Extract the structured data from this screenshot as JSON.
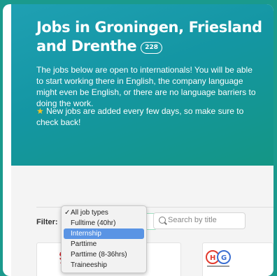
{
  "hero": {
    "title": "Jobs in Groningen, Friesland and Drenthe",
    "count": "228",
    "intro": "The jobs below are open to internationals! You will be able to start working there in English, the company language might even be English, or there are no language barriers to doing the work.",
    "note": "New jobs are added every few days, so make sure to check back!",
    "note_icon": "star-icon"
  },
  "filter": {
    "label": "Filter:",
    "options": [
      "All job types",
      "Fulltime (40hr)",
      "Internship",
      "Parttime",
      "Parttime (8-36hrs)",
      "Traineeship"
    ],
    "checked": "All job types",
    "highlighted": "Internship"
  },
  "search": {
    "placeholder": "Search by title"
  },
  "colors": {
    "hero_gradient_start": "#1fa0b3",
    "hero_gradient_end": "#149685",
    "frame": "#1a9a8d",
    "highlight": "#5a94e4"
  }
}
